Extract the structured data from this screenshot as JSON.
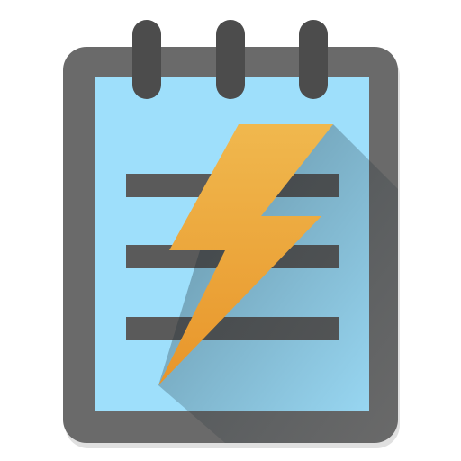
{
  "icon": {
    "name": "notepad-lightning-icon",
    "semantic": "quick-note-app-icon",
    "colors": {
      "frame": "#6a6a6a",
      "frame_shadow": "#555555",
      "page": "#9edffb",
      "lines": "#5a5a5a",
      "rings": "#4c4c4c",
      "bolt_top": "#f0b84e",
      "bolt_bottom": "#e8952a",
      "long_shadow": "#1a2a33"
    },
    "ring_count": 3,
    "text_line_count": 3
  }
}
